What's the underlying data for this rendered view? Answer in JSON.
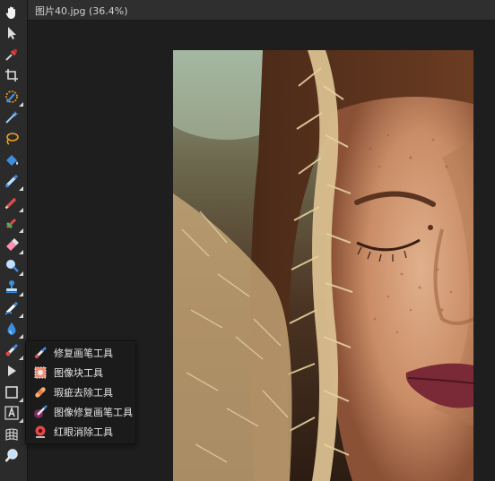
{
  "document": {
    "title": "图片40.jpg (36.4%)"
  },
  "toolbar": {
    "tools": [
      {
        "name": "view-tool",
        "icon": "hand-icon"
      },
      {
        "name": "move-tool",
        "icon": "arrow-cursor-icon"
      },
      {
        "name": "color-picker-tool",
        "icon": "eyedropper-icon"
      },
      {
        "name": "crop-tool",
        "icon": "crop-icon"
      },
      {
        "name": "selection-brush-tool",
        "icon": "selection-brush-icon"
      },
      {
        "name": "magic-wand-tool",
        "icon": "magic-wand-icon"
      },
      {
        "name": "lasso-tool",
        "icon": "lasso-icon"
      },
      {
        "name": "flood-fill-tool",
        "icon": "bucket-icon"
      },
      {
        "name": "paint-brush-tool",
        "icon": "brush-icon"
      },
      {
        "name": "pencil-tool",
        "icon": "pencil-icon"
      },
      {
        "name": "paint-mixer-tool",
        "icon": "mixer-brush-icon"
      },
      {
        "name": "erase-brush-tool",
        "icon": "eraser-icon"
      },
      {
        "name": "dodge-tool",
        "icon": "dodge-icon"
      },
      {
        "name": "clone-tool",
        "icon": "stamp-icon"
      },
      {
        "name": "smudge-tool",
        "icon": "smudge-icon"
      },
      {
        "name": "blur-tool",
        "icon": "drop-icon"
      },
      {
        "name": "healing-brush-tool",
        "icon": "bandage-brush-icon"
      },
      {
        "name": "node-tool",
        "icon": "node-pointer-icon"
      },
      {
        "name": "rectangle-tool",
        "icon": "rectangle-icon"
      },
      {
        "name": "text-tool",
        "icon": "text-icon"
      },
      {
        "name": "mesh-warp-tool",
        "icon": "mesh-icon"
      },
      {
        "name": "zoom-tool",
        "icon": "magnifier-icon"
      }
    ]
  },
  "flyout": {
    "items": [
      {
        "label": "修复画笔工具",
        "icon": "healing-brush-icon"
      },
      {
        "label": "图像块工具",
        "icon": "patch-icon"
      },
      {
        "label": "瑕疵去除工具",
        "icon": "bandage-icon"
      },
      {
        "label": "图像修复画笔工具",
        "icon": "inpainting-brush-icon"
      },
      {
        "label": "红眼消除工具",
        "icon": "red-eye-icon"
      }
    ]
  },
  "colors": {
    "toolbar_bg": "#2b2b2b",
    "canvas_bg": "#1e1e1e",
    "flyout_bg": "#1b1b1b",
    "accent_blue": "#3d8ee0",
    "accent_red": "#e24a4a",
    "accent_orange": "#f0a020"
  }
}
